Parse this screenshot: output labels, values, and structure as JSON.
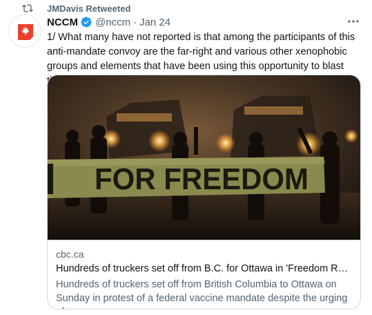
{
  "retweet": {
    "label": "JMDavis Retweeted",
    "icon": "retweet-icon"
  },
  "tweet": {
    "author_name": "NCCM",
    "handle": "@nccm",
    "separator": "·",
    "date": "Jan 24",
    "verified": true,
    "avatar_icon": "nccm-logo",
    "more_icon": "more-icon",
    "text": "1/ What many have not reported is that among the participants of this anti-mandate convoy are the far-right and various other xenophobic groups and elements that have been using this opportunity to blast their message."
  },
  "card": {
    "banner_text": "FOR FREEDOM",
    "domain": "cbc.ca",
    "title": "Hundreds of truckers set off from B.C. for Ottawa in 'Freedom Rally' a...",
    "description": "Hundreds of truckers set off from British Columbia to Ottawa on Sunday in protest of a federal vaccine mandate despite the urging of ..."
  },
  "colors": {
    "accent": "#1d9bf0",
    "secondary_text": "#536471",
    "logo_red": "#e8402a"
  }
}
